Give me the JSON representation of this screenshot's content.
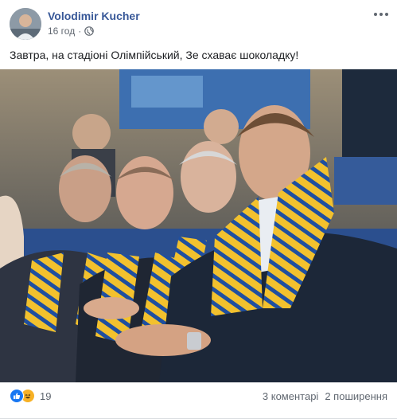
{
  "post": {
    "author": "Volodimir Kucher",
    "time": "16 год",
    "privacy_icon": "globe-icon",
    "text": "Завтра, на стадіоні Олімпійський, Зе схаває шоколадку!",
    "more_icon": "more-options-icon"
  },
  "photo": {
    "alt_subject": "stadium-spectators-photo"
  },
  "footer": {
    "reaction_icons": [
      "like-icon",
      "haha-icon"
    ],
    "reaction_count": "19",
    "comments": "3 коментарі",
    "shares": "2 поширення"
  },
  "colors": {
    "author_link": "#385898",
    "secondary_text": "#606770",
    "like_blue": "#1877f2",
    "haha_yellow": "#f7b125",
    "scarf_yellow": "#f2c12e",
    "scarf_blue": "#1f4fa0"
  }
}
